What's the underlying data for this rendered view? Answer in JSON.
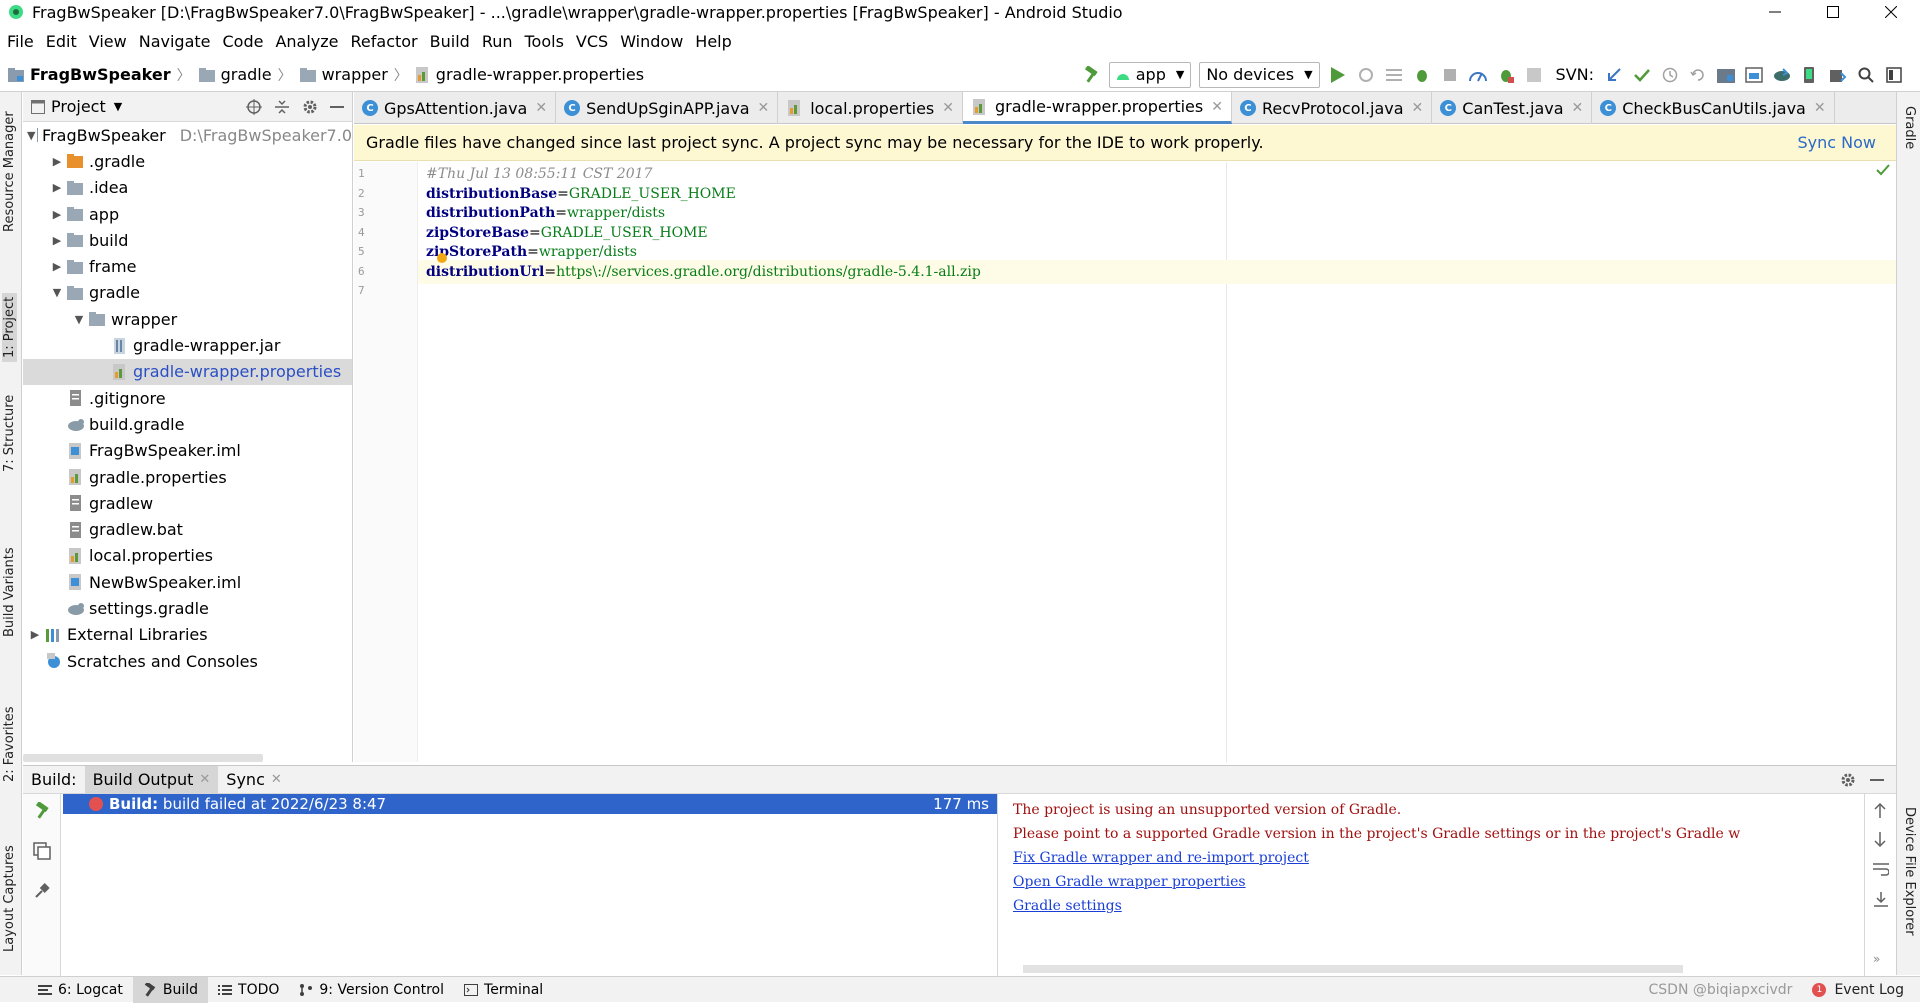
{
  "window": {
    "title": "FragBwSpeaker [D:\\FragBwSpeaker7.0\\FragBwSpeaker] - ...\\gradle\\wrapper\\gradle-wrapper.properties [FragBwSpeaker] - Android Studio"
  },
  "menu": [
    "File",
    "Edit",
    "View",
    "Navigate",
    "Code",
    "Analyze",
    "Refactor",
    "Build",
    "Run",
    "Tools",
    "VCS",
    "Window",
    "Help"
  ],
  "breadcrumb": [
    "FragBwSpeaker",
    "gradle",
    "wrapper",
    "gradle-wrapper.properties"
  ],
  "toolbar": {
    "run_config": "app",
    "device": "No devices",
    "svn_label": "SVN:"
  },
  "left_strip": [
    "Resource Manager",
    "1: Project",
    "7: Structure",
    "Build Variants",
    "2: Favorites",
    "Layout Captures"
  ],
  "right_strip": [
    "Gradle",
    "Device File Explorer"
  ],
  "project_panel": {
    "title": "Project",
    "tree": [
      {
        "label": "FragBwSpeaker",
        "path": "D:\\FragBwSpeaker7.0",
        "depth": 0,
        "arrow": "down",
        "icon": "module"
      },
      {
        "label": ".gradle",
        "depth": 1,
        "arrow": "right",
        "icon": "folder-orange"
      },
      {
        "label": ".idea",
        "depth": 1,
        "arrow": "right",
        "icon": "folder"
      },
      {
        "label": "app",
        "depth": 1,
        "arrow": "right",
        "icon": "folder"
      },
      {
        "label": "build",
        "depth": 1,
        "arrow": "right",
        "icon": "folder"
      },
      {
        "label": "frame",
        "depth": 1,
        "arrow": "right",
        "icon": "folder"
      },
      {
        "label": "gradle",
        "depth": 1,
        "arrow": "down",
        "icon": "folder"
      },
      {
        "label": "wrapper",
        "depth": 2,
        "arrow": "down",
        "icon": "folder"
      },
      {
        "label": "gradle-wrapper.jar",
        "depth": 3,
        "arrow": "",
        "icon": "jar"
      },
      {
        "label": "gradle-wrapper.properties",
        "depth": 3,
        "arrow": "",
        "icon": "props",
        "selected": true
      },
      {
        "label": ".gitignore",
        "depth": 1,
        "arrow": "",
        "icon": "file"
      },
      {
        "label": "build.gradle",
        "depth": 1,
        "arrow": "",
        "icon": "gradle"
      },
      {
        "label": "FragBwSpeaker.iml",
        "depth": 1,
        "arrow": "",
        "icon": "iml"
      },
      {
        "label": "gradle.properties",
        "depth": 1,
        "arrow": "",
        "icon": "props"
      },
      {
        "label": "gradlew",
        "depth": 1,
        "arrow": "",
        "icon": "file"
      },
      {
        "label": "gradlew.bat",
        "depth": 1,
        "arrow": "",
        "icon": "file"
      },
      {
        "label": "local.properties",
        "depth": 1,
        "arrow": "",
        "icon": "props"
      },
      {
        "label": "NewBwSpeaker.iml",
        "depth": 1,
        "arrow": "",
        "icon": "iml"
      },
      {
        "label": "settings.gradle",
        "depth": 1,
        "arrow": "",
        "icon": "gradle"
      },
      {
        "label": "External Libraries",
        "depth": 0,
        "arrow": "right",
        "icon": "libs"
      },
      {
        "label": "Scratches and Consoles",
        "depth": 0,
        "arrow": "",
        "icon": "scratch"
      }
    ]
  },
  "editor_tabs": [
    {
      "label": "GpsAttention.java",
      "icon": "java"
    },
    {
      "label": "SendUpSginAPP.java",
      "icon": "java"
    },
    {
      "label": "local.properties",
      "icon": "props"
    },
    {
      "label": "gradle-wrapper.properties",
      "icon": "props",
      "active": true
    },
    {
      "label": "RecvProtocol.java",
      "icon": "java"
    },
    {
      "label": "CanTest.java",
      "icon": "java"
    },
    {
      "label": "CheckBusCanUtils.java",
      "icon": "java"
    }
  ],
  "notification": {
    "message": "Gradle files have changed since last project sync. A project sync may be necessary for the IDE to work properly.",
    "action": "Sync Now"
  },
  "editor": {
    "lines": [
      {
        "n": "1",
        "comment": "#Thu Jul 13 08:55:11 CST 2017"
      },
      {
        "n": "2",
        "key": "distributionBase",
        "value": "GRADLE_USER_HOME"
      },
      {
        "n": "3",
        "key": "distributionPath",
        "value": "wrapper/dists"
      },
      {
        "n": "4",
        "key": "zipStoreBase",
        "value": "GRADLE_USER_HOME"
      },
      {
        "n": "5",
        "key": "zipStorePath",
        "value": "wrapper/dists"
      },
      {
        "n": "6",
        "key": "distributionUrl",
        "value": "https\\://services.gradle.org/distributions/gradle-5.4.1-all.zip",
        "current": true
      },
      {
        "n": "7"
      }
    ]
  },
  "build_panel": {
    "label": "Build:",
    "tabs": [
      "Build Output",
      "Sync"
    ],
    "result": {
      "prefix": "Build:",
      "text": "build failed at 2022/6/23 8:47",
      "time": "177 ms"
    },
    "console": [
      {
        "text": "The project is using an unsupported version of Gradle.",
        "kind": "error"
      },
      {
        "text": "Please point to a supported Gradle version in the project's Gradle settings or in the project's Gradle w",
        "kind": "error"
      },
      {
        "text": "Fix Gradle wrapper and re-import project",
        "kind": "link"
      },
      {
        "text": "Open Gradle wrapper properties",
        "kind": "link"
      },
      {
        "text": "Gradle settings",
        "kind": "link"
      }
    ]
  },
  "bottom_tabs": [
    {
      "label": "6: Logcat",
      "icon": "logcat"
    },
    {
      "label": "Build",
      "icon": "hammer",
      "active": true
    },
    {
      "label": "TODO",
      "icon": "list"
    },
    {
      "label": "9: Version Control",
      "icon": "vcs"
    },
    {
      "label": "Terminal",
      "icon": "terminal"
    }
  ],
  "status": {
    "watermark": "CSDN @biqiapxcivdr",
    "event_log": "Event Log",
    "event_count": "1"
  }
}
